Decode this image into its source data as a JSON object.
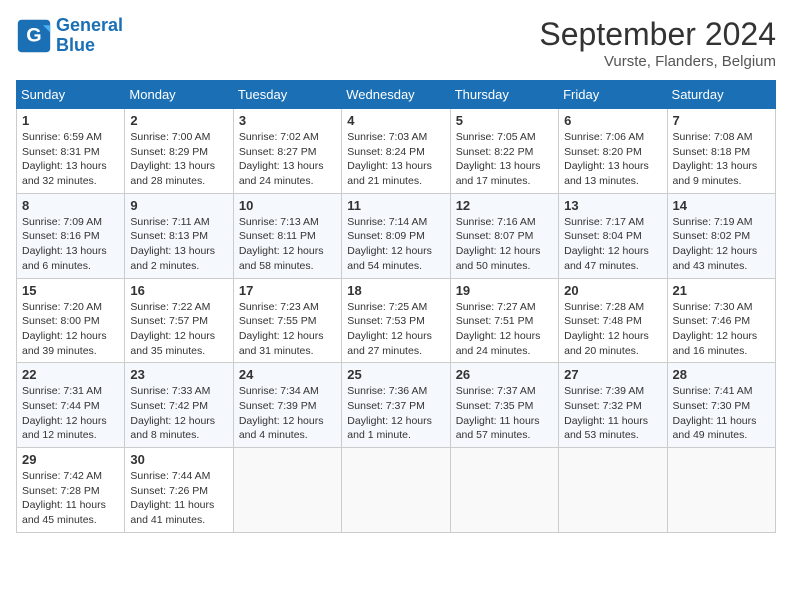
{
  "logo": {
    "line1": "General",
    "line2": "Blue"
  },
  "title": "September 2024",
  "location": "Vurste, Flanders, Belgium",
  "weekdays": [
    "Sunday",
    "Monday",
    "Tuesday",
    "Wednesday",
    "Thursday",
    "Friday",
    "Saturday"
  ],
  "weeks": [
    [
      {
        "day": "1",
        "text": "Sunrise: 6:59 AM\nSunset: 8:31 PM\nDaylight: 13 hours and 32 minutes."
      },
      {
        "day": "2",
        "text": "Sunrise: 7:00 AM\nSunset: 8:29 PM\nDaylight: 13 hours and 28 minutes."
      },
      {
        "day": "3",
        "text": "Sunrise: 7:02 AM\nSunset: 8:27 PM\nDaylight: 13 hours and 24 minutes."
      },
      {
        "day": "4",
        "text": "Sunrise: 7:03 AM\nSunset: 8:24 PM\nDaylight: 13 hours and 21 minutes."
      },
      {
        "day": "5",
        "text": "Sunrise: 7:05 AM\nSunset: 8:22 PM\nDaylight: 13 hours and 17 minutes."
      },
      {
        "day": "6",
        "text": "Sunrise: 7:06 AM\nSunset: 8:20 PM\nDaylight: 13 hours and 13 minutes."
      },
      {
        "day": "7",
        "text": "Sunrise: 7:08 AM\nSunset: 8:18 PM\nDaylight: 13 hours and 9 minutes."
      }
    ],
    [
      {
        "day": "8",
        "text": "Sunrise: 7:09 AM\nSunset: 8:16 PM\nDaylight: 13 hours and 6 minutes."
      },
      {
        "day": "9",
        "text": "Sunrise: 7:11 AM\nSunset: 8:13 PM\nDaylight: 13 hours and 2 minutes."
      },
      {
        "day": "10",
        "text": "Sunrise: 7:13 AM\nSunset: 8:11 PM\nDaylight: 12 hours and 58 minutes."
      },
      {
        "day": "11",
        "text": "Sunrise: 7:14 AM\nSunset: 8:09 PM\nDaylight: 12 hours and 54 minutes."
      },
      {
        "day": "12",
        "text": "Sunrise: 7:16 AM\nSunset: 8:07 PM\nDaylight: 12 hours and 50 minutes."
      },
      {
        "day": "13",
        "text": "Sunrise: 7:17 AM\nSunset: 8:04 PM\nDaylight: 12 hours and 47 minutes."
      },
      {
        "day": "14",
        "text": "Sunrise: 7:19 AM\nSunset: 8:02 PM\nDaylight: 12 hours and 43 minutes."
      }
    ],
    [
      {
        "day": "15",
        "text": "Sunrise: 7:20 AM\nSunset: 8:00 PM\nDaylight: 12 hours and 39 minutes."
      },
      {
        "day": "16",
        "text": "Sunrise: 7:22 AM\nSunset: 7:57 PM\nDaylight: 12 hours and 35 minutes."
      },
      {
        "day": "17",
        "text": "Sunrise: 7:23 AM\nSunset: 7:55 PM\nDaylight: 12 hours and 31 minutes."
      },
      {
        "day": "18",
        "text": "Sunrise: 7:25 AM\nSunset: 7:53 PM\nDaylight: 12 hours and 27 minutes."
      },
      {
        "day": "19",
        "text": "Sunrise: 7:27 AM\nSunset: 7:51 PM\nDaylight: 12 hours and 24 minutes."
      },
      {
        "day": "20",
        "text": "Sunrise: 7:28 AM\nSunset: 7:48 PM\nDaylight: 12 hours and 20 minutes."
      },
      {
        "day": "21",
        "text": "Sunrise: 7:30 AM\nSunset: 7:46 PM\nDaylight: 12 hours and 16 minutes."
      }
    ],
    [
      {
        "day": "22",
        "text": "Sunrise: 7:31 AM\nSunset: 7:44 PM\nDaylight: 12 hours and 12 minutes."
      },
      {
        "day": "23",
        "text": "Sunrise: 7:33 AM\nSunset: 7:42 PM\nDaylight: 12 hours and 8 minutes."
      },
      {
        "day": "24",
        "text": "Sunrise: 7:34 AM\nSunset: 7:39 PM\nDaylight: 12 hours and 4 minutes."
      },
      {
        "day": "25",
        "text": "Sunrise: 7:36 AM\nSunset: 7:37 PM\nDaylight: 12 hours and 1 minute."
      },
      {
        "day": "26",
        "text": "Sunrise: 7:37 AM\nSunset: 7:35 PM\nDaylight: 11 hours and 57 minutes."
      },
      {
        "day": "27",
        "text": "Sunrise: 7:39 AM\nSunset: 7:32 PM\nDaylight: 11 hours and 53 minutes."
      },
      {
        "day": "28",
        "text": "Sunrise: 7:41 AM\nSunset: 7:30 PM\nDaylight: 11 hours and 49 minutes."
      }
    ],
    [
      {
        "day": "29",
        "text": "Sunrise: 7:42 AM\nSunset: 7:28 PM\nDaylight: 11 hours and 45 minutes."
      },
      {
        "day": "30",
        "text": "Sunrise: 7:44 AM\nSunset: 7:26 PM\nDaylight: 11 hours and 41 minutes."
      },
      null,
      null,
      null,
      null,
      null
    ]
  ]
}
